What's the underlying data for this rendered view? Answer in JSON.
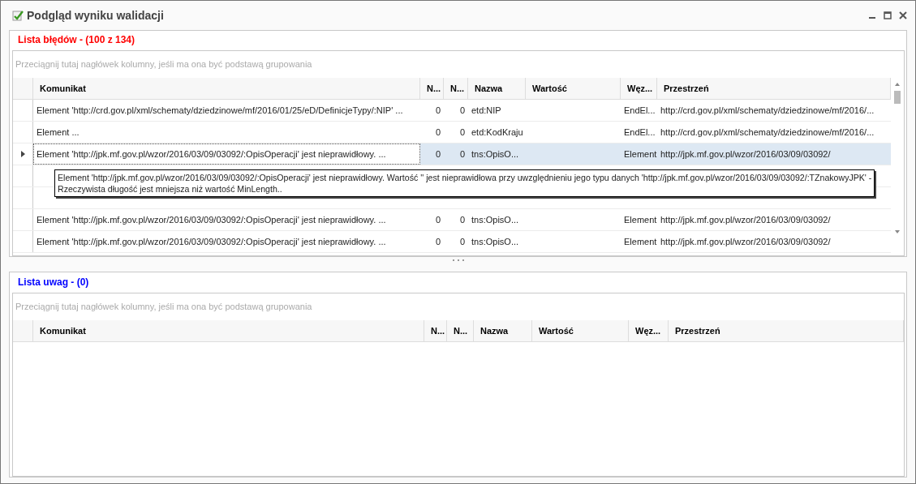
{
  "window": {
    "title": "Podgląd wyniku walidacji"
  },
  "error_list": {
    "title": "Lista błędów - (100 z 134)",
    "group_panel": {
      "placeholder": "Przeciągnij tutaj nagłówek kolumny, jeśli ma ona być podstawą grupowania"
    },
    "columns": [
      "Komunikat",
      "N...",
      "N...",
      "Nazwa",
      "Wartość",
      "Węz...",
      "Przestrzeń"
    ],
    "rows": [
      {
        "selected": false,
        "cells": [
          "Element 'http://crd.gov.pl/xml/schematy/dziedzinowe/mf/2016/01/25/eD/DefinicjeTypy/:NIP' ...",
          "0",
          "0",
          "etd:NIP",
          "",
          "EndEl...",
          "http://crd.gov.pl/xml/schematy/dziedzinowe/mf/2016/..."
        ]
      },
      {
        "selected": false,
        "cells": [
          "Element ...",
          "0",
          "0",
          "etd:KodKraju",
          "",
          "EndEl...",
          "http://crd.gov.pl/xml/schematy/dziedzinowe/mf/2016/..."
        ]
      },
      {
        "selected": true,
        "cells": [
          "Element 'http://jpk.mf.gov.pl/wzor/2016/03/09/03092/:OpisOperacji' jest nieprawidłowy. ...",
          "0",
          "0",
          "tns:OpisO...",
          "",
          "Element",
          "http://jpk.mf.gov.pl/wzor/2016/03/09/03092/"
        ]
      },
      {
        "selected": false
      },
      {
        "selected": false
      },
      {
        "selected": false,
        "cells": [
          "Element 'http://jpk.mf.gov.pl/wzor/2016/03/09/03092/:OpisOperacji' jest nieprawidłowy. ...",
          "0",
          "0",
          "tns:OpisO...",
          "",
          "Element",
          "http://jpk.mf.gov.pl/wzor/2016/03/09/03092/"
        ]
      },
      {
        "selected": false,
        "cells": [
          "Element 'http://jpk.mf.gov.pl/wzor/2016/03/09/03092/:OpisOperacji' jest nieprawidłowy. ...",
          "0",
          "0",
          "tns:OpisO...",
          "",
          "Element",
          "http://jpk.mf.gov.pl/wzor/2016/03/09/03092/"
        ]
      }
    ]
  },
  "tooltip": {
    "lines": [
      "Element 'http://jpk.mf.gov.pl/wzor/2016/03/09/03092/:OpisOperacji' jest nieprawidłowy. Wartość '' jest nieprawidłowa przy uwzględnieniu jego typu danych 'http://jpk.mf.gov.pl/wzor/2016/03/09/03092/:TZnakowyJPK' -",
      "Rzeczywista długość jest mniejsza niż wartość MinLength.."
    ]
  },
  "notes_list": {
    "title": "Lista uwag - (0)",
    "group_panel": {
      "placeholder": "Przeciągnij tutaj nagłówek kolumny, jeśli ma ona być podstawą grupowania"
    },
    "columns": [
      "Komunikat",
      "N...",
      "N...",
      "Nazwa",
      "Wartość",
      "Węz...",
      "Przestrzeń"
    ]
  }
}
